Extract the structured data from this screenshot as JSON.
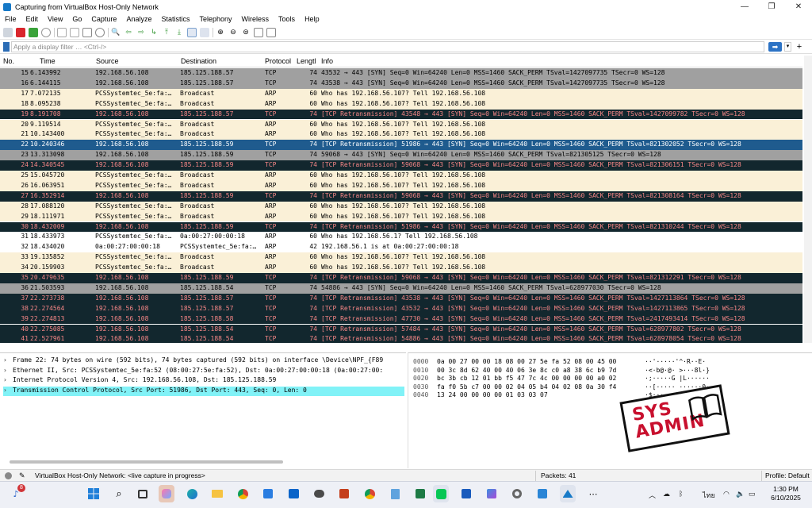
{
  "window": {
    "title": "Capturing from VirtualBox Host-Only Network",
    "minimize": "—",
    "maximize": "❐",
    "close": "✕"
  },
  "menu": [
    "File",
    "Edit",
    "View",
    "Go",
    "Capture",
    "Analyze",
    "Statistics",
    "Telephony",
    "Wireless",
    "Tools",
    "Help"
  ],
  "filter": {
    "placeholder": "Apply a display filter … <Ctrl-/>",
    "apply": "➡",
    "dropdown": "▾",
    "add": "+"
  },
  "columns": [
    "No.",
    "Time",
    "Source",
    "Destination",
    "Protocol",
    "Lengtl",
    "Info"
  ],
  "colors": {
    "tcp_gray": "#a0a0a0",
    "arp_beige": "#faf0d7",
    "retrans_dark": "#12272e",
    "retrans_fg": "#f78787",
    "selected_blue": "#1f5b8e",
    "tcp_lightgray": "#c5c5c5",
    "detail_selected": "#81f2f7"
  },
  "packets": [
    {
      "no": "15",
      "time": "6.143992",
      "src": "192.168.56.108",
      "dst": "185.125.188.57",
      "proto": "TCP",
      "len": "74",
      "info": "43532 → 443 [SYN] Seq=0 Win=64240 Len=0 MSS=1460 SACK_PERM TSval=1427097735 TSecr=0 WS=128",
      "style": "gray"
    },
    {
      "no": "16",
      "time": "6.144115",
      "src": "192.168.56.108",
      "dst": "185.125.188.57",
      "proto": "TCP",
      "len": "74",
      "info": "43538 → 443 [SYN] Seq=0 Win=64240 Len=0 MSS=1460 SACK_PERM TSval=1427097735 TSecr=0 WS=128",
      "style": "gray"
    },
    {
      "no": "17",
      "time": "7.072135",
      "src": "PCSSystemtec_5e:fa:…",
      "dst": "Broadcast",
      "proto": "ARP",
      "len": "60",
      "info": "Who has 192.168.56.107? Tell 192.168.56.108",
      "style": "arp"
    },
    {
      "no": "18",
      "time": "8.095238",
      "src": "PCSSystemtec_5e:fa:…",
      "dst": "Broadcast",
      "proto": "ARP",
      "len": "60",
      "info": "Who has 192.168.56.107? Tell 192.168.56.108",
      "style": "arp"
    },
    {
      "no": "19",
      "time": "8.191708",
      "src": "192.168.56.108",
      "dst": "185.125.188.57",
      "proto": "TCP",
      "len": "74",
      "info": "[TCP Retransmission] 43548 → 443 [SYN] Seq=0 Win=64240 Len=0 MSS=1460 SACK_PERM TSval=1427099782 TSecr=0 WS=128",
      "style": "dark"
    },
    {
      "no": "20",
      "time": "9.119514",
      "src": "PCSSystemtec_5e:fa:…",
      "dst": "Broadcast",
      "proto": "ARP",
      "len": "60",
      "info": "Who has 192.168.56.107? Tell 192.168.56.108",
      "style": "arp"
    },
    {
      "no": "21",
      "time": "10.143400",
      "src": "PCSSystemtec_5e:fa:…",
      "dst": "Broadcast",
      "proto": "ARP",
      "len": "60",
      "info": "Who has 192.168.56.107? Tell 192.168.56.108",
      "style": "arp"
    },
    {
      "no": "22",
      "time": "10.240346",
      "src": "192.168.56.108",
      "dst": "185.125.188.59",
      "proto": "TCP",
      "len": "74",
      "info": "[TCP Retransmission] 51986 → 443 [SYN] Seq=0 Win=64240 Len=0 MSS=1460 SACK_PERM TSval=821302052 TSecr=0 WS=128",
      "style": "selected"
    },
    {
      "no": "23",
      "time": "13.313098",
      "src": "192.168.56.108",
      "dst": "185.125.188.59",
      "proto": "TCP",
      "len": "74",
      "info": "59068 → 443 [SYN] Seq=0 Win=64240 Len=0 MSS=1460 SACK_PERM TSval=821305125 TSecr=0 WS=128",
      "style": "gray"
    },
    {
      "no": "24",
      "time": "14.340545",
      "src": "192.168.56.108",
      "dst": "185.125.188.59",
      "proto": "TCP",
      "len": "74",
      "info": "[TCP Retransmission] 59068 → 443 [SYN] Seq=0 Win=64240 Len=0 MSS=1460 SACK_PERM TSval=821306151 TSecr=0 WS=128",
      "style": "dark"
    },
    {
      "no": "25",
      "time": "15.045720",
      "src": "PCSSystemtec_5e:fa:…",
      "dst": "Broadcast",
      "proto": "ARP",
      "len": "60",
      "info": "Who has 192.168.56.107? Tell 192.168.56.108",
      "style": "arp"
    },
    {
      "no": "26",
      "time": "16.063951",
      "src": "PCSSystemtec_5e:fa:…",
      "dst": "Broadcast",
      "proto": "ARP",
      "len": "60",
      "info": "Who has 192.168.56.107? Tell 192.168.56.108",
      "style": "arp"
    },
    {
      "no": "27",
      "time": "16.352914",
      "src": "192.168.56.108",
      "dst": "185.125.188.59",
      "proto": "TCP",
      "len": "74",
      "info": "[TCP Retransmission] 59068 → 443 [SYN] Seq=0 Win=64240 Len=0 MSS=1460 SACK_PERM TSval=821308164 TSecr=0 WS=128",
      "style": "dark"
    },
    {
      "no": "28",
      "time": "17.088120",
      "src": "PCSSystemtec_5e:fa:…",
      "dst": "Broadcast",
      "proto": "ARP",
      "len": "60",
      "info": "Who has 192.168.56.107? Tell 192.168.56.108",
      "style": "arp"
    },
    {
      "no": "29",
      "time": "18.111971",
      "src": "PCSSystemtec_5e:fa:…",
      "dst": "Broadcast",
      "proto": "ARP",
      "len": "60",
      "info": "Who has 192.168.56.107? Tell 192.168.56.108",
      "style": "arp"
    },
    {
      "no": "30",
      "time": "18.432009",
      "src": "192.168.56.108",
      "dst": "185.125.188.59",
      "proto": "TCP",
      "len": "74",
      "info": "[TCP Retransmission] 51986 → 443 [SYN] Seq=0 Win=64240 Len=0 MSS=1460 SACK_PERM TSval=821310244 TSecr=0 WS=128",
      "style": "dark"
    },
    {
      "no": "31",
      "time": "18.433973",
      "src": "PCSSystemtec_5e:fa:…",
      "dst": "0a:00:27:00:00:18",
      "proto": "ARP",
      "len": "60",
      "info": "Who has 192.168.56.1? Tell 192.168.56.108",
      "style": "white"
    },
    {
      "no": "32",
      "time": "18.434020",
      "src": "0a:00:27:00:00:18",
      "dst": "PCSSystemtec_5e:fa:…",
      "proto": "ARP",
      "len": "42",
      "info": "192.168.56.1 is at 0a:00:27:00:00:18",
      "style": "white"
    },
    {
      "no": "33",
      "time": "19.135852",
      "src": "PCSSystemtec_5e:fa:…",
      "dst": "Broadcast",
      "proto": "ARP",
      "len": "60",
      "info": "Who has 192.168.56.107? Tell 192.168.56.108",
      "style": "arp"
    },
    {
      "no": "34",
      "time": "20.159903",
      "src": "PCSSystemtec_5e:fa:…",
      "dst": "Broadcast",
      "proto": "ARP",
      "len": "60",
      "info": "Who has 192.168.56.107? Tell 192.168.56.108",
      "style": "arp"
    },
    {
      "no": "35",
      "time": "20.479635",
      "src": "192.168.56.108",
      "dst": "185.125.188.59",
      "proto": "TCP",
      "len": "74",
      "info": "[TCP Retransmission] 59068 → 443 [SYN] Seq=0 Win=64240 Len=0 MSS=1460 SACK_PERM TSval=821312291 TSecr=0 WS=128",
      "style": "dark"
    },
    {
      "no": "36",
      "time": "21.503593",
      "src": "192.168.56.108",
      "dst": "185.125.188.54",
      "proto": "TCP",
      "len": "74",
      "info": "54886 → 443 [SYN] Seq=0 Win=64240 Len=0 MSS=1460 SACK_PERM TSval=628977030 TSecr=0 WS=128",
      "style": "gray"
    },
    {
      "no": "37",
      "time": "22.273738",
      "src": "192.168.56.108",
      "dst": "185.125.188.57",
      "proto": "TCP",
      "len": "74",
      "info": "[TCP Retransmission] 43538 → 443 [SYN] Seq=0 Win=64240 Len=0 MSS=1460 SACK_PERM TSval=1427113864 TSecr=0 WS=128",
      "style": "dark"
    },
    {
      "no": "38",
      "time": "22.274564",
      "src": "192.168.56.108",
      "dst": "185.125.188.57",
      "proto": "TCP",
      "len": "74",
      "info": "[TCP Retransmission] 43532 → 443 [SYN] Seq=0 Win=64240 Len=0 MSS=1460 SACK_PERM TSval=1427113865 TSecr=0 WS=128",
      "style": "dark"
    },
    {
      "no": "39",
      "time": "22.274813",
      "src": "192.168.56.108",
      "dst": "185.125.188.58",
      "proto": "TCP",
      "len": "74",
      "info": "[TCP Retransmission] 47730 → 443 [SYN] Seq=0 Win=64240 Len=0 MSS=1460 SACK_PERM TSval=2417493414 TSecr=0 WS=128",
      "style": "dark"
    },
    {
      "no": "40",
      "time": "22.275085",
      "src": "192.168.56.108",
      "dst": "185.125.188.54",
      "proto": "TCP",
      "len": "74",
      "info": "[TCP Retransmission] 57484 → 443 [SYN] Seq=0 Win=64240 Len=0 MSS=1460 SACK_PERM TSval=628977802 TSecr=0 WS=128",
      "style": "dark"
    },
    {
      "no": "41",
      "time": "22.527961",
      "src": "192.168.56.108",
      "dst": "185.125.188.54",
      "proto": "TCP",
      "len": "74",
      "info": "[TCP Retransmission] 54886 → 443 [SYN] Seq=0 Win=64240 Len=0 MSS=1460 SACK_PERM TSval=628978054 TSecr=0 WS=128",
      "style": "dark"
    }
  ],
  "details": [
    {
      "text": "Frame 22: 74 bytes on wire (592 bits), 74 bytes captured (592 bits) on interface \\Device\\NPF_{F89",
      "selected": false
    },
    {
      "text": "Ethernet II, Src: PCSSystemtec_5e:fa:52 (08:00:27:5e:fa:52), Dst: 0a:00:27:00:00:18 (0a:00:27:00:",
      "selected": false
    },
    {
      "text": "Internet Protocol Version 4, Src: 192.168.56.108, Dst: 185.125.188.59",
      "selected": false
    },
    {
      "text": "Transmission Control Protocol, Src Port: 51986, Dst Port: 443, Seq: 0, Len: 0",
      "selected": true
    }
  ],
  "bytes": [
    {
      "off": "0000",
      "hex": "0a 00 27 00 00 18 08 00  27 5e fa 52 08 00 45 00",
      "ascii": "··'·····'^·R··E·"
    },
    {
      "off": "0010",
      "hex": "00 3c 8d 62 40 00 40 06  3e 8c c0 a8 38 6c b9 7d",
      "ascii": "·<·b@·@· >···8l·}"
    },
    {
      "off": "0020",
      "hex": "bc 3b cb 12 01 bb f5 47  7c 4c 00 00 00 00 a0 02",
      "ascii": "·;·····G |L······"
    },
    {
      "off": "0030",
      "hex": "fa f0 5b c7 00 00 02 04  05 b4 04 02 08 0a 30 f4",
      "ascii": "··[·····  ······0·"
    },
    {
      "off": "0040",
      "hex": "13 24 00 00 00 00 01 03  03 07",
      "ascii": "·$········"
    }
  ],
  "stamp": {
    "line1": "SYS",
    "line2": "ADMIN"
  },
  "status": {
    "interface": "VirtualBox Host-Only Network: <live capture in progress>",
    "packets": "Packets: 41",
    "profile": "Profile: Default"
  },
  "taskbar": {
    "badge": "8",
    "lang": "ไทย",
    "time": "1:30 PM",
    "date": "6/10/2025"
  }
}
